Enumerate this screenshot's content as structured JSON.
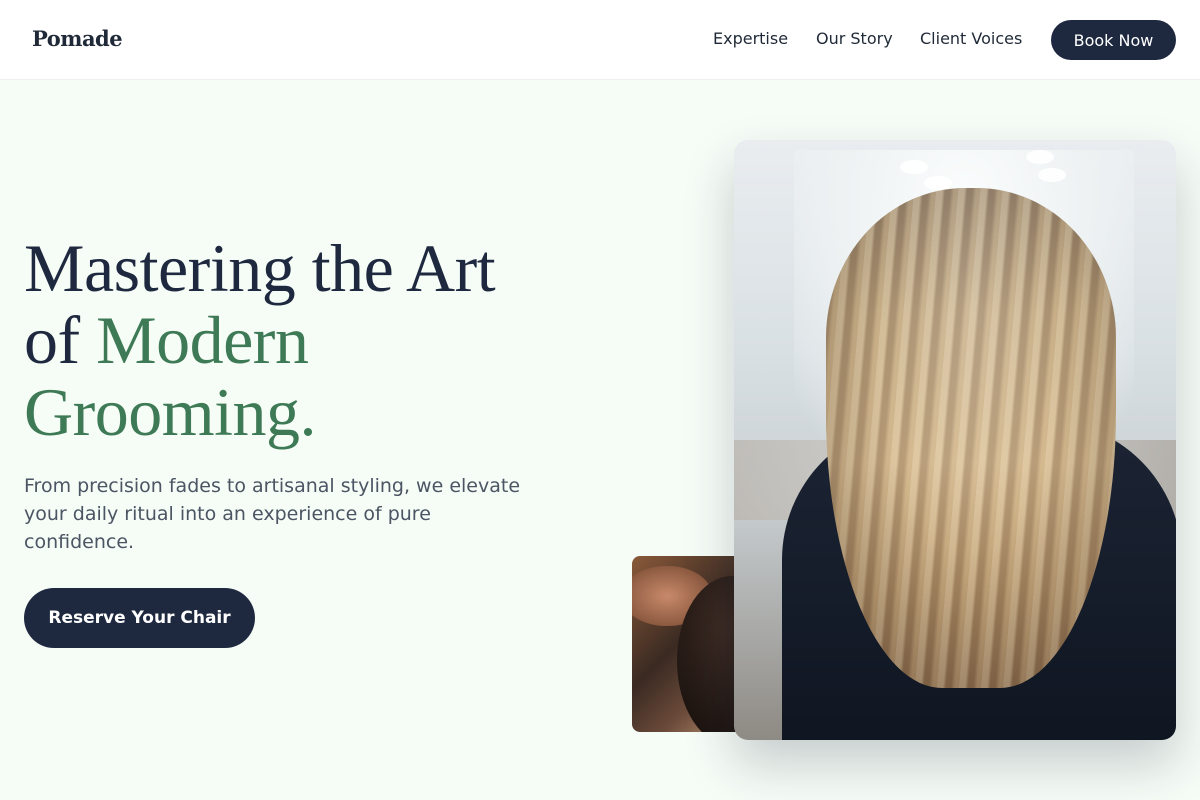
{
  "brand": {
    "name": "Pomade"
  },
  "nav": {
    "links": [
      "Expertise",
      "Our Story",
      "Client Voices"
    ],
    "cta": "Book Now"
  },
  "hero": {
    "title_line1": "Mastering the Art",
    "title_of": "of",
    "title_accent1": "Modern",
    "title_accent2": "Grooming.",
    "subtitle": "From precision fades to artisanal styling, we elevate your daily ritual into an experience of pure confidence.",
    "cta": "Reserve Your Chair"
  },
  "images": {
    "main": "woman-long-blonde-hair-salon-photo",
    "secondary": "barber-fade-haircut-photo"
  },
  "colors": {
    "navy": "#1e2940",
    "accent_green": "#3d7a55",
    "background": "#f6fcf6"
  }
}
